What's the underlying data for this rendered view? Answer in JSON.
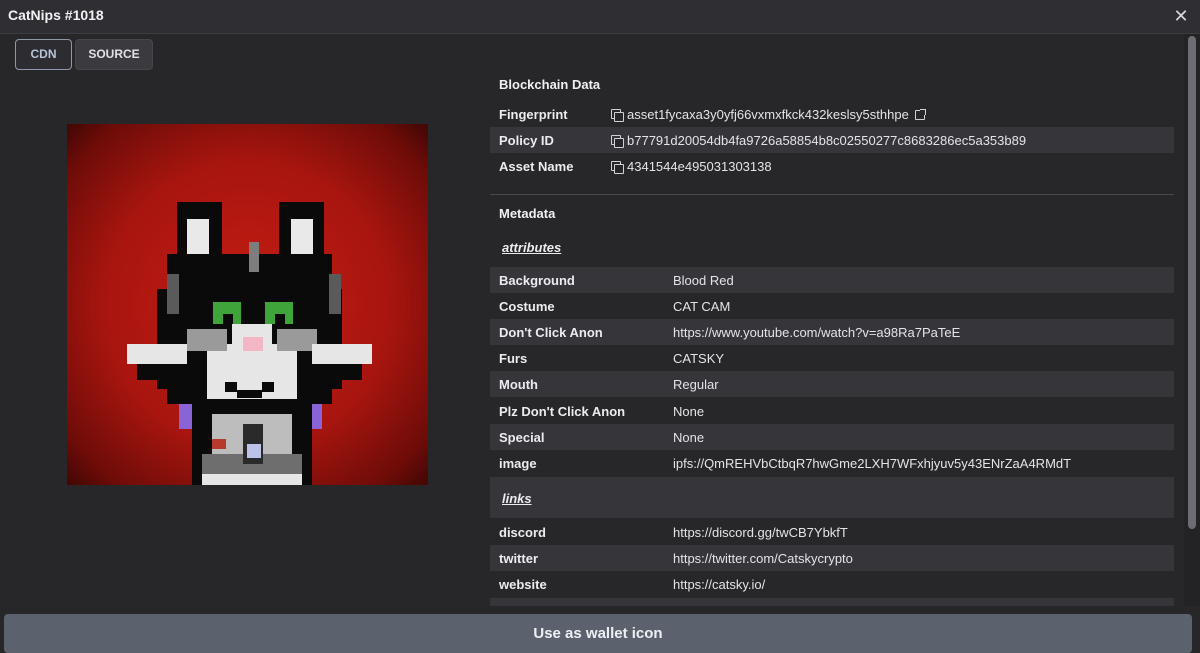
{
  "window": {
    "title": "CatNips #1018",
    "close_glyph": "✕"
  },
  "tabs": [
    {
      "label": "CDN",
      "active": true
    },
    {
      "label": "SOURCE",
      "active": false
    }
  ],
  "image": {
    "alt": "pixel-art cat NFT on blood red background"
  },
  "blockchain": {
    "title": "Blockchain Data",
    "rows": [
      {
        "key": "Fingerprint",
        "value": "asset1fycaxa3y0yfj66vxmxfkck432keslsy5sthhpe",
        "icons": [
          "copy-icon",
          "external-link-icon"
        ]
      },
      {
        "key": "Policy ID",
        "value": "b77791d20054db4fa9726a58854b8c02550277c8683286ec5a353b89",
        "icons": [
          "copy-icon"
        ]
      },
      {
        "key": "Asset Name",
        "value": "4341544e495031303138",
        "icons": [
          "copy-icon"
        ]
      }
    ]
  },
  "metadata": {
    "title": "Metadata",
    "attributes_label": "attributes",
    "attributes": [
      {
        "key": "Background",
        "value": "Blood Red"
      },
      {
        "key": "Costume",
        "value": "CAT CAM"
      },
      {
        "key": "Don't Click Anon",
        "value": "https://www.youtube.com/watch?v=a98Ra7PaTeE"
      },
      {
        "key": "Furs",
        "value": "CATSKY"
      },
      {
        "key": "Mouth",
        "value": "Regular"
      },
      {
        "key": "Plz Don't Click Anon",
        "value": "None"
      },
      {
        "key": "Special",
        "value": "None"
      },
      {
        "key": "image",
        "value": "ipfs://QmREHVbCtbqR7hwGme2LXH7WFxhjyuv5y43ENrZaA4RMdT"
      }
    ],
    "links_label": "links",
    "links": [
      {
        "key": "discord",
        "value": "https://discord.gg/twCB7YbkfT"
      },
      {
        "key": "twitter",
        "value": "https://twitter.com/Catskycrypto"
      },
      {
        "key": "website",
        "value": "https://catsky.io/"
      }
    ]
  },
  "footer": {
    "button_label": "Use as wallet icon"
  },
  "colors": {
    "panel": "#27272a",
    "row_shade": "#36363a",
    "button": "#5b626d",
    "accent": "#b8c4d8",
    "art_background": "#a8150f"
  }
}
